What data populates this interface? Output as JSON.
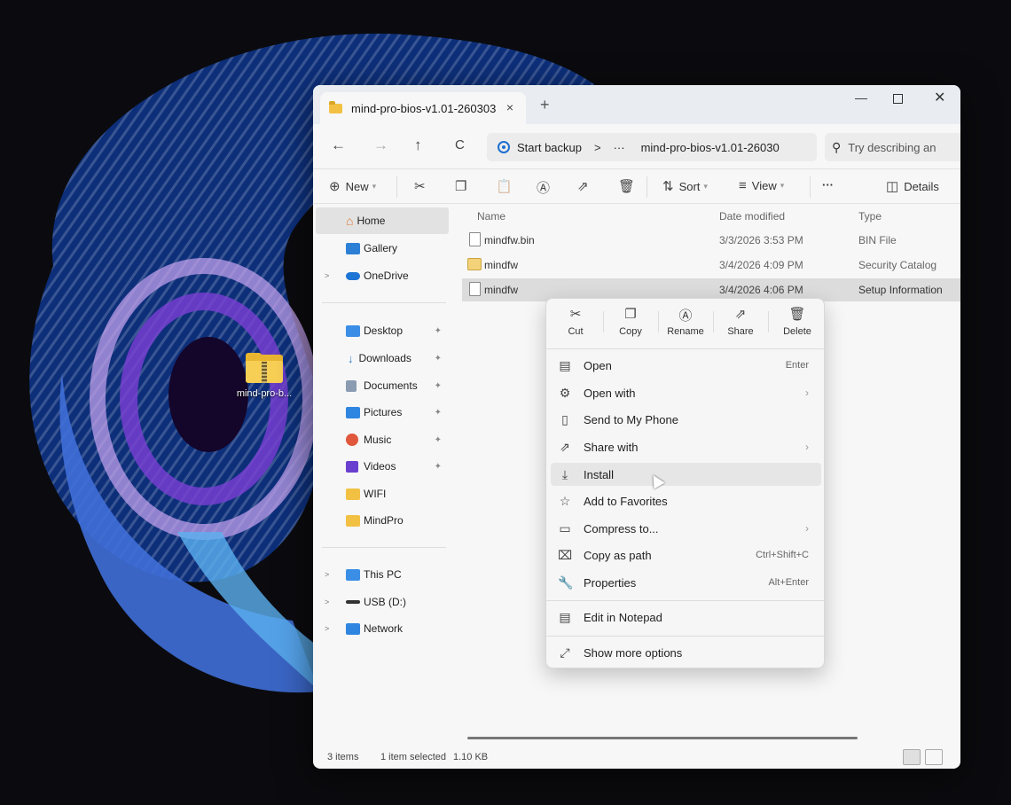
{
  "desktop": {
    "shortcut_label": "mind-pro-b..."
  },
  "window": {
    "tab_title": "mind-pro-bios-v1.01-260303",
    "tab_close": "×",
    "new_tab": "+",
    "minimize": "—",
    "close": "✕"
  },
  "navbar": {
    "back": "←",
    "forward": "→",
    "up": "↑",
    "refresh": "C",
    "address": {
      "root": "Start backup",
      "sep1": ">",
      "ellipsis": "···",
      "current": "mind-pro-bios-v1.01-26030"
    },
    "search_placeholder": "Try describing an"
  },
  "toolbar": {
    "new_label": "New",
    "sort_label": "Sort",
    "view_label": "View",
    "more_label": "···",
    "details_label": "Details"
  },
  "sidebar": {
    "items": [
      {
        "label": "Home"
      },
      {
        "label": "Gallery"
      },
      {
        "label": "OneDrive"
      },
      {
        "label": "Desktop"
      },
      {
        "label": "Downloads"
      },
      {
        "label": "Documents"
      },
      {
        "label": "Pictures"
      },
      {
        "label": "Music"
      },
      {
        "label": "Videos"
      },
      {
        "label": "WIFI"
      },
      {
        "label": "MindPro"
      },
      {
        "label": "This PC"
      },
      {
        "label": "USB (D:)"
      },
      {
        "label": "Network"
      }
    ]
  },
  "files": {
    "columns": [
      "Name",
      "Date modified",
      "Type"
    ],
    "rows": [
      {
        "name": "mindfw.bin",
        "date": "3/3/2026 3:53 PM",
        "type": "BIN File"
      },
      {
        "name": "mindfw",
        "date": "3/4/2026 4:09 PM",
        "type": "Security Catalog"
      },
      {
        "name": "mindfw",
        "date": "3/4/2026 4:06 PM",
        "type": "Setup Information"
      }
    ]
  },
  "status": {
    "items_count": "3 items",
    "selection": "1 item selected",
    "size": "1.10 KB"
  },
  "context_menu": {
    "quick_actions": [
      {
        "label": "Cut",
        "icon": "scissors-icon"
      },
      {
        "label": "Copy",
        "icon": "copy-icon"
      },
      {
        "label": "Rename",
        "icon": "rename-icon"
      },
      {
        "label": "Share",
        "icon": "share-icon"
      },
      {
        "label": "Delete",
        "icon": "trash-icon"
      }
    ],
    "items": [
      {
        "label": "Open",
        "shortcut": "Enter"
      },
      {
        "label": "Open with"
      },
      {
        "label": "Send to My Phone"
      },
      {
        "label": "Share with"
      },
      {
        "label": "Install"
      },
      {
        "label": "Add to Favorites"
      },
      {
        "label": "Compress to..."
      },
      {
        "label": "Copy as path",
        "shortcut": "Ctrl+Shift+C"
      },
      {
        "label": "Properties",
        "shortcut": "Alt+Enter"
      },
      {
        "label": "Edit in Notepad"
      },
      {
        "label": "Show more options"
      }
    ]
  },
  "colors": {
    "accent": "#1f6fd1",
    "folder": "#f2c144",
    "wallpaper_blue": "#2f7de0",
    "wallpaper_purple": "#8a4fd8"
  }
}
